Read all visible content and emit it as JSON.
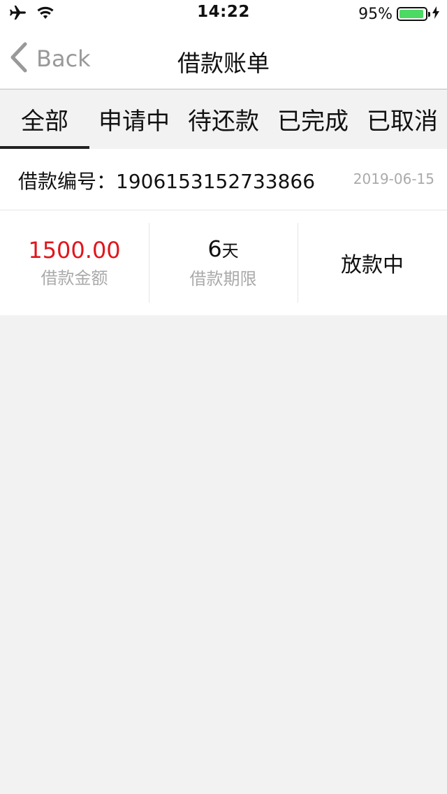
{
  "status_bar": {
    "time": "14:22",
    "battery_percent": "95%",
    "battery_level": 0.95,
    "icons": [
      "airplane-icon",
      "wifi-icon",
      "battery-icon",
      "charging-bolt-icon"
    ]
  },
  "nav": {
    "back_label": "Back",
    "title": "借款账单"
  },
  "tabs": [
    {
      "label": "全部",
      "active": true
    },
    {
      "label": "申请中",
      "active": false
    },
    {
      "label": "待还款",
      "active": false
    },
    {
      "label": "已完成",
      "active": false
    },
    {
      "label": "已取消",
      "active": false
    }
  ],
  "loan": {
    "number_text": "借款编号：1906153152733866",
    "date": "2019-06-15",
    "amount": "1500.00",
    "amount_label": "借款金额",
    "term_value": "6",
    "term_unit": "天",
    "term_label": "借款期限",
    "status": "放款中"
  },
  "colors": {
    "amount": "#e0161c",
    "battery_fill": "#4cd964",
    "page_background": "#f2f2f2"
  }
}
